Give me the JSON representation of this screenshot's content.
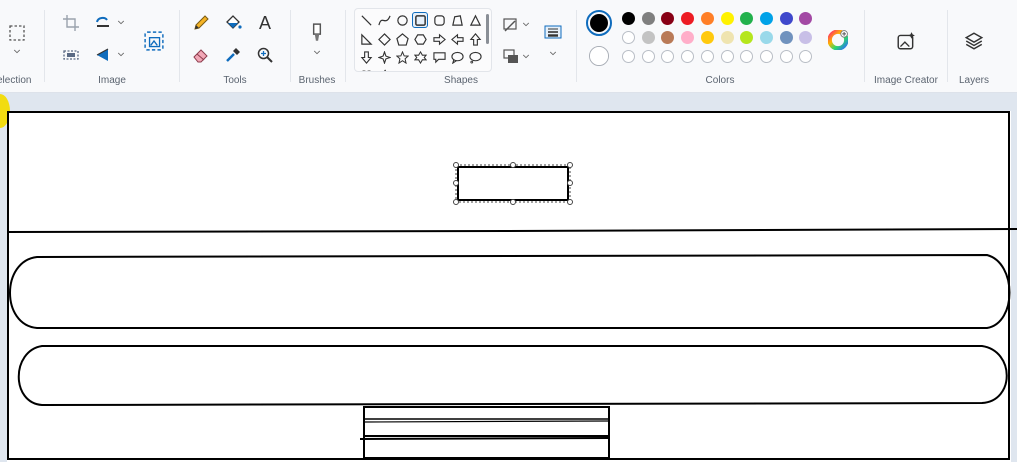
{
  "ribbon": {
    "groups": {
      "selection": "election",
      "image": "Image",
      "tools": "Tools",
      "brushes": "Brushes",
      "shapes": "Shapes",
      "colors": "Colors",
      "image_creator": "Image Creator",
      "layers": "Layers"
    },
    "tools": {
      "text_glyph": "A"
    }
  },
  "colors": {
    "color1": "#000000",
    "color2": "#ffffff",
    "palette_row1": [
      "#000000",
      "#7f7f7f",
      "#880015",
      "#ed1c24",
      "#ff7f27",
      "#fff200",
      "#22b14c",
      "#00a2e8",
      "#3f48cc",
      "#a349a4"
    ],
    "palette_row2": [
      "#ffffff",
      "#c3c3c3",
      "#b97a57",
      "#ffaec9",
      "#ffc90e",
      "#efe4b0",
      "#b5e61d",
      "#99d9ea",
      "#7092be",
      "#c8bfe7"
    ],
    "palette_row3_empty_count": 10,
    "accent": "#0f6cbd"
  },
  "canvas": {
    "background": "#ffffff",
    "stroke": "#000000"
  }
}
